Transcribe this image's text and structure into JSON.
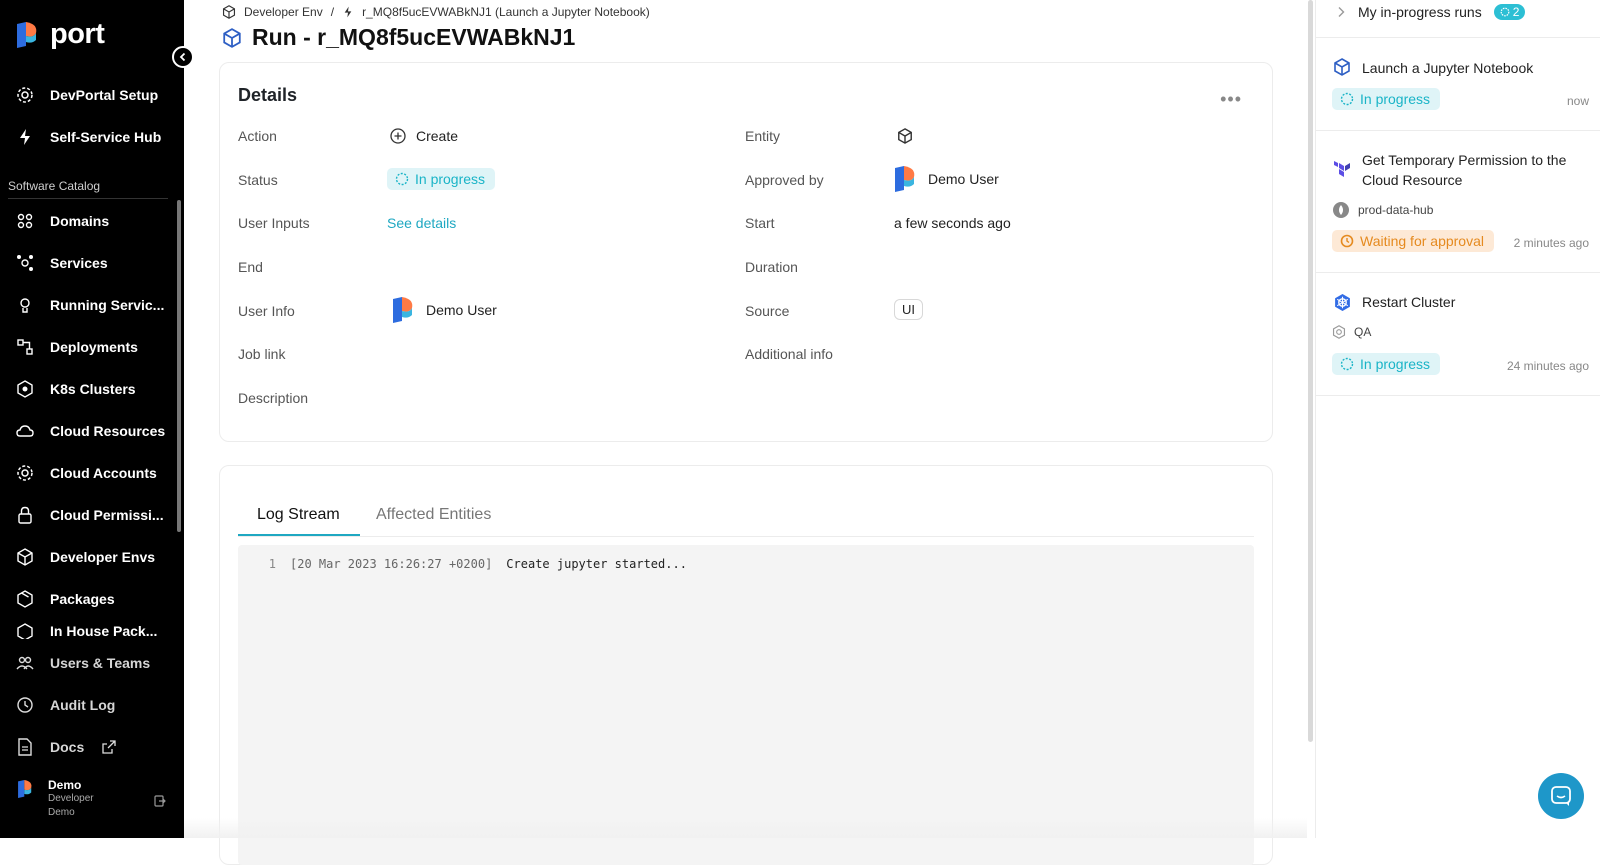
{
  "app": {
    "brand": "port",
    "accent": "#1fa8c2"
  },
  "sidebar": {
    "top_items": [
      {
        "label": "DevPortal Setup",
        "icon": "gear-icon"
      },
      {
        "label": "Self-Service Hub",
        "icon": "bolt-icon"
      }
    ],
    "section_label": "Software Catalog",
    "catalog_items": [
      {
        "label": "Domains",
        "icon": "domains-icon"
      },
      {
        "label": "Services",
        "icon": "services-icon"
      },
      {
        "label": "Running Servic...",
        "icon": "running-services-icon"
      },
      {
        "label": "Deployments",
        "icon": "deployments-icon"
      },
      {
        "label": "K8s Clusters",
        "icon": "kubernetes-icon"
      },
      {
        "label": "Cloud Resources",
        "icon": "cloud-icon"
      },
      {
        "label": "Cloud Accounts",
        "icon": "gear-icon"
      },
      {
        "label": "Cloud Permissi...",
        "icon": "lock-icon"
      },
      {
        "label": "Developer Envs",
        "icon": "cube-icon"
      },
      {
        "label": "Packages",
        "icon": "package-icon"
      },
      {
        "label": "In House Pack...",
        "icon": "package-icon"
      }
    ],
    "bottom_items": [
      {
        "label": "Users & Teams",
        "icon": "users-icon"
      },
      {
        "label": "Audit Log",
        "icon": "history-icon"
      },
      {
        "label": "Docs",
        "icon": "docs-icon"
      }
    ],
    "user": {
      "name": "Demo",
      "role": "Developer",
      "org": "Demo"
    }
  },
  "breadcrumb": {
    "parent": "Developer Env",
    "separator": "/",
    "current": "r_MQ8f5ucEVWABkNJ1 (Launch a Jupyter Notebook)"
  },
  "page_title": "Run - r_MQ8f5ucEVWABkNJ1",
  "details": {
    "title": "Details",
    "more": "•••",
    "labels": {
      "action": "Action",
      "status": "Status",
      "user_inputs": "User Inputs",
      "end": "End",
      "user_info": "User Info",
      "job_link": "Job link",
      "description": "Description",
      "entity": "Entity",
      "approved_by": "Approved by",
      "start": "Start",
      "duration": "Duration",
      "source": "Source",
      "additional_info": "Additional info"
    },
    "values": {
      "action": "Create",
      "status": "In progress",
      "user_inputs": "See details",
      "user_info": "Demo User",
      "approved_by": "Demo User",
      "start": "a few seconds ago",
      "source": "UI"
    }
  },
  "log": {
    "tabs": [
      "Log Stream",
      "Affected Entities"
    ],
    "lines": [
      {
        "num": "1",
        "timestamp": "[20 Mar 2023 16:26:27 +0200]",
        "message": "Create jupyter started..."
      }
    ]
  },
  "runs_panel": {
    "header": "My in-progress runs",
    "count": "2",
    "items": [
      {
        "title": "Launch a Jupyter Notebook",
        "status": "In progress",
        "time": "now",
        "icon": "cube-icon"
      },
      {
        "title": "Get Temporary Permission to the Cloud Resource",
        "entity": "prod-data-hub",
        "status": "Waiting for approval",
        "time": "2 minutes ago",
        "icon": "terraform-icon"
      },
      {
        "title": "Restart Cluster",
        "entity": "QA",
        "status": "In progress",
        "time": "24 minutes ago",
        "icon": "kubernetes-icon"
      }
    ],
    "status_colors": {
      "in_progress": "#1ab4c7",
      "waiting": "#e58a1f"
    }
  }
}
